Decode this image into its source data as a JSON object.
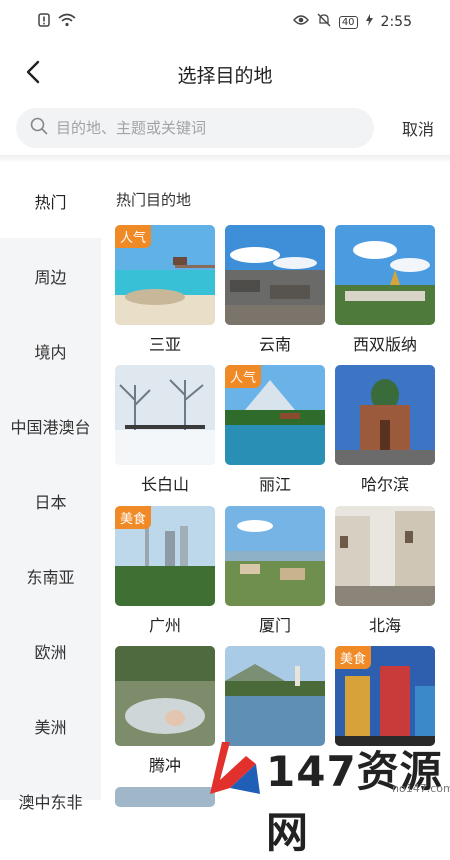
{
  "status_bar": {
    "time": "2:55",
    "battery": "40"
  },
  "header": {
    "title": "选择目的地"
  },
  "search": {
    "placeholder": "目的地、主题或关键词",
    "value": "",
    "cancel_label": "取消"
  },
  "sidebar": {
    "items": [
      {
        "label": "热门",
        "active": true
      },
      {
        "label": "周边"
      },
      {
        "label": "境内"
      },
      {
        "label": "中国港澳台"
      },
      {
        "label": "日本"
      },
      {
        "label": "东南亚"
      },
      {
        "label": "欧洲"
      },
      {
        "label": "美洲"
      },
      {
        "label": "澳中东非"
      }
    ]
  },
  "content": {
    "section_title": "热门目的地",
    "destinations": [
      {
        "name": "三亚",
        "badge": "人气"
      },
      {
        "name": "云南"
      },
      {
        "name": "西双版纳"
      },
      {
        "name": "长白山"
      },
      {
        "name": "丽江",
        "badge": "人气"
      },
      {
        "name": "哈尔滨"
      },
      {
        "name": "广州",
        "badge": "美食"
      },
      {
        "name": "厦门"
      },
      {
        "name": "北海"
      },
      {
        "name": "腾冲"
      },
      {
        "name": ""
      },
      {
        "name": "",
        "badge": "美食"
      }
    ]
  },
  "watermark": {
    "text": "147资源网",
    "url": "no147.com"
  },
  "colors": {
    "badge": "#f08a26",
    "sidebar_bg": "#f4f5f7",
    "search_bg": "#f2f3f5"
  }
}
